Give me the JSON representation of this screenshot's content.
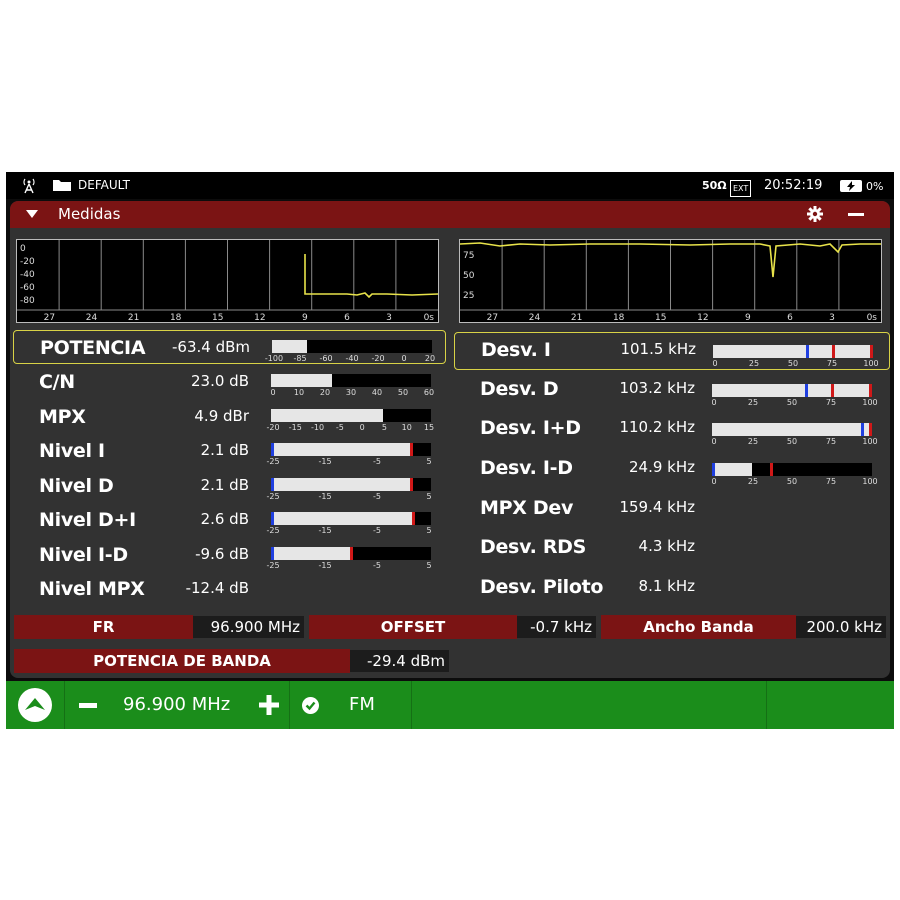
{
  "status": {
    "profile": "DEFAULT",
    "impedance": "50Ω",
    "ext": "EXT",
    "time": "20:52:19",
    "battery": "0%"
  },
  "window": {
    "title": "Medidas"
  },
  "graph_left": {
    "y_labels": [
      "0",
      "-20",
      "-40",
      "-60",
      "-80"
    ],
    "x_labels": [
      "27",
      "24",
      "21",
      "18",
      "15",
      "12",
      "9",
      "6",
      "3",
      "0s"
    ]
  },
  "graph_right": {
    "y_labels": [
      "75",
      "50",
      "25"
    ],
    "x_labels": [
      "27",
      "24",
      "21",
      "18",
      "15",
      "12",
      "9",
      "6",
      "3",
      "0s"
    ]
  },
  "left_measures": [
    {
      "name": "POTENCIA",
      "value": "-63.4 dBm",
      "level": 0.22,
      "marker": null,
      "ticks": [
        "-100",
        "-85",
        "-60",
        "-40",
        "-20",
        "0",
        "20"
      ]
    },
    {
      "name": "C/N",
      "value": "23.0 dB",
      "level": 0.38,
      "marker": null,
      "ticks": [
        "0",
        "10",
        "20",
        "30",
        "40",
        "50",
        "60"
      ]
    },
    {
      "name": "MPX",
      "value": "4.9 dBr",
      "level": 0.7,
      "marker": null,
      "ticks": [
        "-20",
        "-15",
        "-10",
        "-5",
        "0",
        "5",
        "10",
        "15"
      ]
    },
    {
      "name": "Nivel I",
      "value": "2.1 dB",
      "level": 0.89,
      "marker": "red",
      "ticks": [
        "-25",
        "-15",
        "-5",
        "5"
      ]
    },
    {
      "name": "Nivel D",
      "value": "2.1 dB",
      "level": 0.89,
      "marker": "red",
      "ticks": [
        "-25",
        "-15",
        "-5",
        "5"
      ]
    },
    {
      "name": "Nivel D+I",
      "value": "2.6 dB",
      "level": 0.9,
      "marker": "red",
      "ticks": [
        "-25",
        "-15",
        "-5",
        "5"
      ]
    },
    {
      "name": "Nivel I-D",
      "value": "-9.6 dB",
      "level": 0.51,
      "marker": "red",
      "ticks": [
        "-25",
        "-15",
        "-5",
        "5"
      ]
    },
    {
      "name": "Nivel MPX",
      "value": "-12.4 dB",
      "level": null,
      "marker": null,
      "ticks": []
    }
  ],
  "right_measures": [
    {
      "name": "Desv. I",
      "value": "101.5 kHz",
      "level": 1.0,
      "blue": 0.59,
      "red": 0.75,
      "ticks": [
        "0",
        "25",
        "50",
        "75",
        "100"
      ]
    },
    {
      "name": "Desv. D",
      "value": "103.2 kHz",
      "level": 1.0,
      "blue": 0.59,
      "red": 0.75,
      "ticks": [
        "0",
        "25",
        "50",
        "75",
        "100"
      ]
    },
    {
      "name": "Desv. I+D",
      "value": "110.2 kHz",
      "level": 1.0,
      "blue": 0.94,
      "red": null,
      "ticks": [
        "0",
        "25",
        "50",
        "75",
        "100"
      ]
    },
    {
      "name": "Desv. I-D",
      "value": "24.9 kHz",
      "level": 0.25,
      "blue": null,
      "red": 0.37,
      "ticks": [
        "0",
        "25",
        "50",
        "75",
        "100"
      ]
    },
    {
      "name": "MPX Dev",
      "value": "159.4 kHz"
    },
    {
      "name": "Desv. RDS",
      "value": "4.3 kHz"
    },
    {
      "name": "Desv. Piloto",
      "value": "8.1 kHz"
    }
  ],
  "info": {
    "fr_label": "FR",
    "fr_value": "96.900 MHz",
    "offset_label": "OFFSET",
    "offset_value": "-0.7 kHz",
    "bw_label": "Ancho Banda",
    "bw_value": "200.0 kHz",
    "band_power_label": "POTENCIA DE BANDA",
    "band_power_value": "-29.4 dBm"
  },
  "bottom": {
    "frequency": "96.900 MHz",
    "mode": "FM"
  },
  "colors": {
    "accent_red": "#7b1414",
    "bottom_green": "#1b8d1b",
    "trace_yellow": "#e8e34a",
    "selection": "#d8d246"
  }
}
